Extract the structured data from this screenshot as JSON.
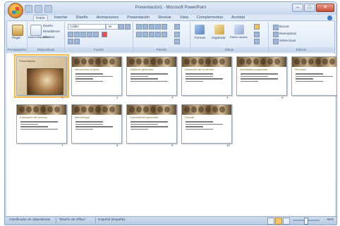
{
  "window": {
    "title": "Presentación1 - Microsoft PowerPoint"
  },
  "window_controls": [
    "–",
    "□",
    "✕"
  ],
  "tabs": [
    "Inicio",
    "Insertar",
    "Diseño",
    "Animaciones",
    "Presentación",
    "Revisar",
    "Vista",
    "Complementos",
    "Acrobat"
  ],
  "ribbon": {
    "clipboard": {
      "label": "Portapapeles",
      "paste": "Pegar"
    },
    "slides": {
      "label": "Diapositivas",
      "new_slide": "Nueva diapositiva",
      "layout": "Diseño",
      "reset": "Restablecer",
      "delete": "Eliminar"
    },
    "font": {
      "label": "Fuente",
      "font_name": "Calibri",
      "font_size": "18"
    },
    "paragraph": {
      "label": "Párrafo"
    },
    "drawing": {
      "label": "Dibujo",
      "shapes": "Formas",
      "arrange": "Organizar",
      "quick_styles": "Estilos rápidos"
    },
    "editing": {
      "label": "Edición",
      "find": "Buscar",
      "replace": "Reemplazar",
      "select": "Seleccionar"
    }
  },
  "slides": [
    {
      "n": "1",
      "title": "Presentación",
      "cover": true
    },
    {
      "n": "2",
      "title": "Introducción al tema",
      "cover": false
    },
    {
      "n": "3",
      "title": "Objetivos generales",
      "cover": false
    },
    {
      "n": "4",
      "title": "Desarrollo del contenido",
      "cover": false
    },
    {
      "n": "5",
      "title": "Actividades propuestas",
      "cover": false
    },
    {
      "n": "6",
      "title": "Recursos",
      "cover": false
    },
    {
      "n": "7",
      "title": "Evaluación del proceso",
      "cover": false
    },
    {
      "n": "8",
      "title": "Metodología",
      "cover": false
    },
    {
      "n": "9",
      "title": "Conclusiones generales",
      "cover": false
    },
    {
      "n": "10",
      "title": "Gracias",
      "cover": false
    }
  ],
  "statusbar": {
    "view": "Clasificador de diapositivas",
    "theme": "\"Diseño de Office\"",
    "language": "Español (España)",
    "zoom": "66%"
  }
}
